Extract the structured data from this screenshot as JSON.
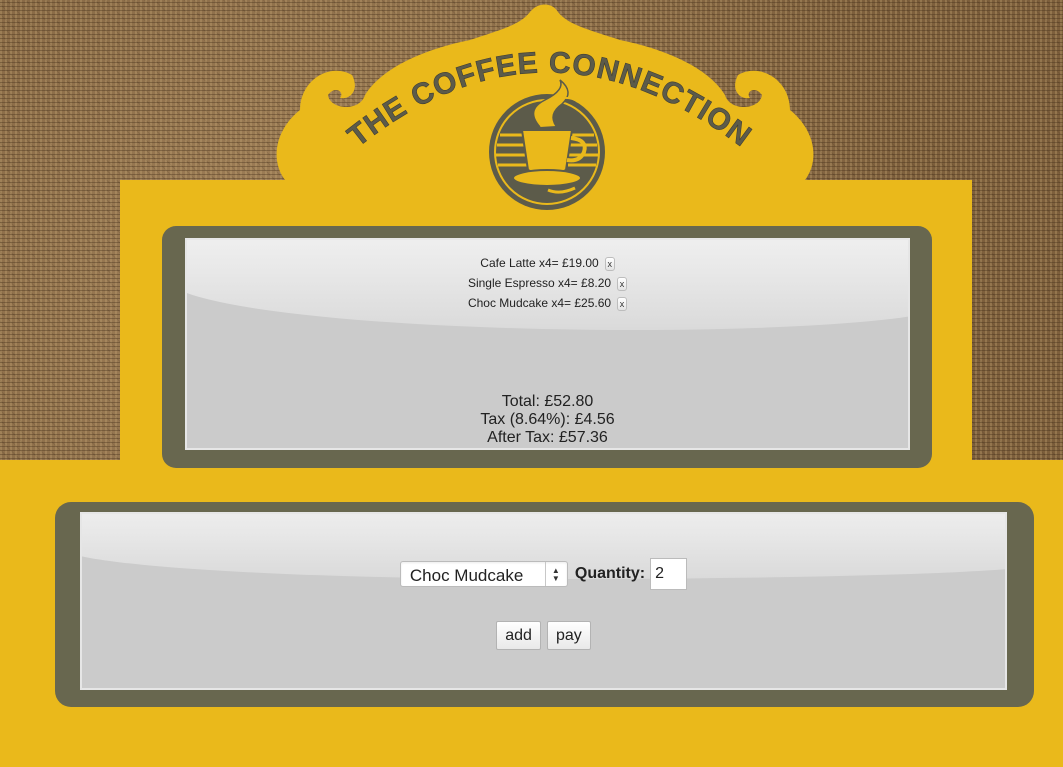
{
  "brand": {
    "name": "THE COFFEE CONNECTION",
    "colors": {
      "sign": "#eab91b",
      "frame": "#68674f",
      "screen": "#cbcbcb",
      "logo_ink": "#5c5b4a"
    }
  },
  "order": {
    "items": [
      {
        "label": "Cafe Latte x4= £19.00",
        "remove": "x"
      },
      {
        "label": "Single Espresso x4= £8.20",
        "remove": "x"
      },
      {
        "label": "Choc Mudcake x4= £25.60",
        "remove": "x"
      }
    ],
    "total": "Total: £52.80",
    "tax": "Tax (8.64%): £4.56",
    "after_tax": "After Tax: £57.36"
  },
  "form": {
    "product_selected": "Choc Mudcake",
    "quantity_label": "Quantity:",
    "quantity_value": "2",
    "add_label": "add",
    "pay_label": "pay"
  },
  "icons": [
    "coffee-cup-logo-icon",
    "select-arrows-icon"
  ]
}
